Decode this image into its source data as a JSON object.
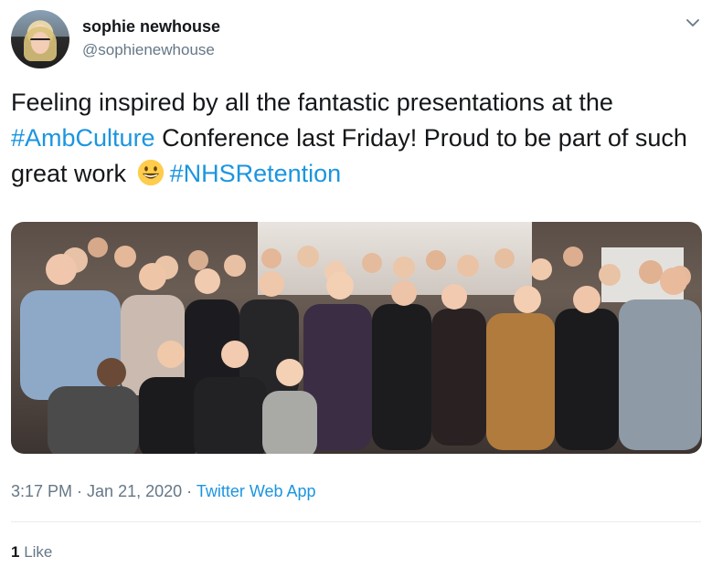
{
  "author": {
    "display_name": "sophie newhouse",
    "handle": "@sophienewhouse"
  },
  "tweet": {
    "text_part1": "Feeling inspired by all the fantastic presentations at the ",
    "hashtag1": "#AmbCulture",
    "text_part2": " Conference last Friday! Proud to be part of such great work ",
    "emoji": "grinning-face-emoji",
    "hashtag2": "#NHSRetention"
  },
  "meta": {
    "time": "3:17 PM",
    "separator1": " · ",
    "date": "Jan 21, 2020",
    "separator2": " · ",
    "source": "Twitter Web App"
  },
  "stats": {
    "likes_count": "1",
    "likes_label": "Like"
  },
  "colors": {
    "text": "#14171a",
    "secondary": "#657786",
    "link": "#1b95e0",
    "border": "#e6ecf0"
  },
  "icons": {
    "caret": "chevron-down-icon"
  }
}
